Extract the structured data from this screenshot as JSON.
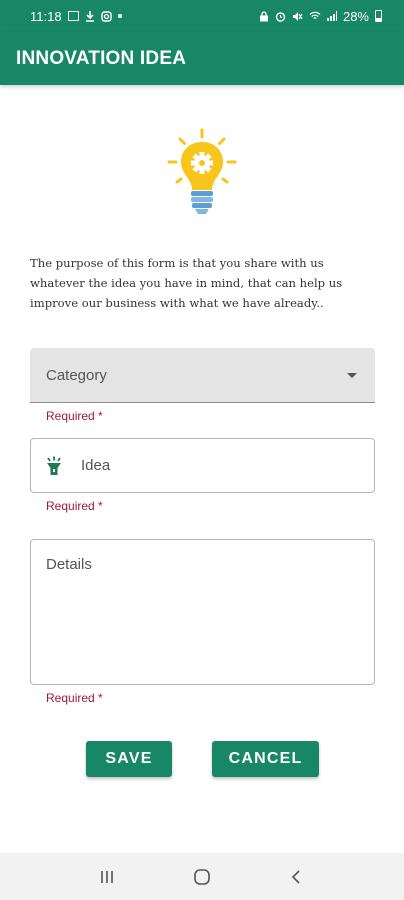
{
  "status_bar": {
    "time": "11:18",
    "battery": "28%",
    "left_icons": [
      "image-icon",
      "download-icon",
      "instagram-icon",
      "dot-icon"
    ],
    "right_icons": [
      "lock-icon",
      "alarm-icon",
      "mute-icon",
      "wifi-icon",
      "signal-icon",
      "battery-icon"
    ]
  },
  "app_bar": {
    "title": "INNOVATION IDEA"
  },
  "hero_icon": "lightbulb-gear-icon",
  "intro": {
    "text": "The purpose of this form is that you share with us whatever the idea you have in mind, that can help us improve our business with what we have already.."
  },
  "form": {
    "category": {
      "label": "Category",
      "helper": "Required *"
    },
    "idea": {
      "placeholder": "Idea",
      "value": "",
      "icon": "flashlight-icon",
      "helper": "Required *"
    },
    "details": {
      "placeholder": "Details",
      "value": "",
      "helper": "Required *"
    }
  },
  "buttons": {
    "save": "SAVE",
    "cancel": "CANCEL"
  },
  "nav_bar": {
    "icons": [
      "recents-icon",
      "home-icon",
      "back-icon"
    ]
  },
  "colors": {
    "primary": "#178766",
    "error": "#a3193a",
    "bulb": "#f8c51c",
    "bulb_base": "#5a9fd6"
  }
}
